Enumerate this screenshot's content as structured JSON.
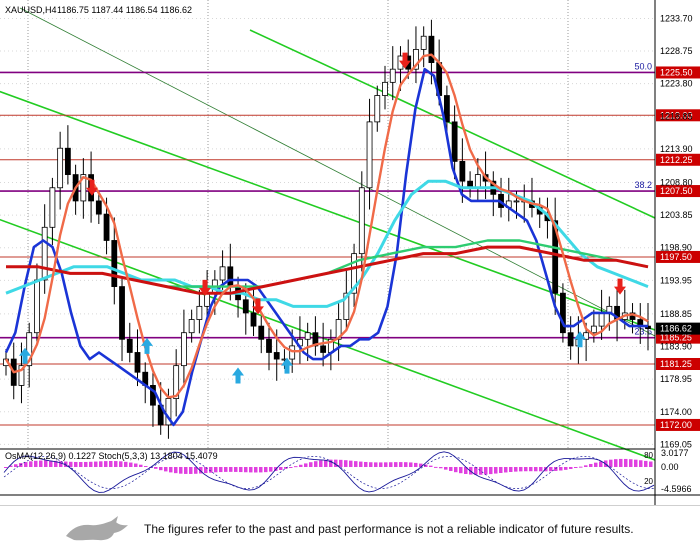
{
  "header": {
    "symbol": "XAUUSD,H4",
    "ohlc": "1186.75 1187.44 1186.54 1186.62"
  },
  "indicator_label": "OsMA(12,26,9) 0.1227  Stoch(5,3,3) 13.1804 15.4079",
  "footer": {
    "disclaimer": "The figures refer to the past and past performance is not a reliable indicator of future results."
  },
  "colors": {
    "level_line": "#800080",
    "level_label_bg": "#cc0000",
    "current_price_bg": "#000000",
    "ema_blue": "#1a34d6",
    "ema_cyan": "#3fd9e6",
    "ema_red": "#cc1111",
    "ema_salmon": "#f06a48",
    "channel_green": "#22cc22",
    "up_arrow": "#29a9e0",
    "down_arrow": "#e8211b",
    "osma_bar": "#e040e0"
  },
  "chart_data": {
    "type": "candlestick",
    "symbol": "XAUUSD",
    "timeframe": "H4",
    "ylim": [
      1168.5,
      1236.5
    ],
    "y_ticks": [
      1233.7,
      1228.75,
      1223.8,
      1218.85,
      1213.9,
      1208.8,
      1203.85,
      1198.9,
      1193.95,
      1188.85,
      1183.9,
      1178.95,
      1174.0,
      1169.05
    ],
    "horizontal_levels": [
      {
        "price": 1225.5,
        "label": "1225.50",
        "fib": "50.0"
      },
      {
        "price": 1219.0,
        "label": "1219.00"
      },
      {
        "price": 1212.25,
        "label": "1212.25"
      },
      {
        "price": 1207.5,
        "label": "1207.50",
        "fib": "38.2"
      },
      {
        "price": 1197.5,
        "label": "1197.50"
      },
      {
        "price": 1185.25,
        "label": "1185.25",
        "fib": "23.6"
      },
      {
        "price": 1181.25,
        "label": "1181.25"
      },
      {
        "price": 1172.0,
        "label": "1172.00"
      }
    ],
    "current_price": 1186.62,
    "closes": [
      1182,
      1178,
      1181,
      1186,
      1194,
      1202,
      1208,
      1214,
      1210,
      1206,
      1210,
      1206,
      1204,
      1200,
      1193,
      1185,
      1183,
      1180,
      1178,
      1175,
      1172,
      1176,
      1181,
      1186,
      1188,
      1190,
      1192,
      1194,
      1196,
      1193,
      1191,
      1189,
      1187,
      1185,
      1183,
      1182,
      1182,
      1184,
      1185,
      1186,
      1184,
      1183,
      1185,
      1188,
      1192,
      1198,
      1208,
      1218,
      1222,
      1224,
      1226,
      1228,
      1226,
      1229,
      1231,
      1227,
      1222,
      1218,
      1212,
      1209,
      1208,
      1210,
      1209,
      1207,
      1205,
      1206,
      1206,
      1206,
      1205,
      1204,
      1203,
      1192,
      1186,
      1184,
      1185,
      1186,
      1187,
      1189,
      1190,
      1188,
      1189,
      1188,
      1187,
      1186.62
    ],
    "ma_lines": [
      {
        "name": "ema_blue",
        "values": [
          1183,
          1186,
          1193,
          1199,
          1200,
          1199,
          1195,
          1189,
          1184,
          1182,
          1183,
          1182,
          1181,
          1180,
          1179,
          1178,
          1177,
          1174,
          1172,
          1174,
          1180,
          1185,
          1190,
          1193,
          1194,
          1194,
          1194,
          1193,
          1191,
          1189,
          1187,
          1185,
          1183,
          1182,
          1182,
          1183,
          1184,
          1184,
          1185,
          1185,
          1186,
          1190,
          1198,
          1210,
          1220,
          1226,
          1225,
          1219,
          1211,
          1207,
          1206,
          1206,
          1206,
          1206,
          1205,
          1204,
          1203,
          1200,
          1195,
          1190,
          1187,
          1187,
          1188,
          1189,
          1189,
          1189,
          1188,
          1187,
          1187,
          1187
        ]
      },
      {
        "name": "ema_cyan",
        "values": [
          1192,
          1193,
          1194,
          1195,
          1196,
          1196,
          1196,
          1195,
          1194,
          1194,
          1194,
          1193,
          1193,
          1192,
          1192,
          1191,
          1191,
          1190,
          1190,
          1190,
          1191,
          1194,
          1198,
          1203,
          1207,
          1209,
          1209,
          1208,
          1208,
          1208,
          1207,
          1206,
          1204,
          1201,
          1198,
          1196,
          1195,
          1194,
          1193
        ]
      },
      {
        "name": "ema_green",
        "values": [
          1196,
          1196,
          1195,
          1195,
          1194,
          1193,
          1193,
          1193,
          1193,
          1194,
          1195,
          1197,
          1198,
          1199,
          1199,
          1200,
          1200,
          1199,
          1198,
          1197,
          1196
        ]
      },
      {
        "name": "ema_red",
        "values": [
          1196,
          1196,
          1195,
          1195,
          1194,
          1193,
          1192,
          1192,
          1193,
          1194,
          1195,
          1196,
          1197,
          1198,
          1198,
          1199,
          1199,
          1198,
          1197,
          1197,
          1196
        ]
      }
    ],
    "signal_arrows": [
      {
        "dir": "down",
        "price": 1208.0
      },
      {
        "dir": "down",
        "price": 1192.8
      },
      {
        "dir": "down",
        "price": 1190.0
      },
      {
        "dir": "down",
        "price": 1227.3
      },
      {
        "dir": "down",
        "price": 1193.0
      },
      {
        "dir": "up",
        "price": 1182.5
      },
      {
        "dir": "up",
        "price": 1184.0
      },
      {
        "dir": "up",
        "price": 1179.5
      },
      {
        "dir": "up",
        "price": 1181.0
      },
      {
        "dir": "up",
        "price": 1185.0
      }
    ],
    "oscillators": {
      "osma": 0.1227,
      "stoch_main": 13.1804,
      "stoch_signal": 15.4079,
      "osma_ticks": [
        "3.0177",
        "0.00",
        "-4.5966"
      ],
      "stoch_levels": [
        80,
        20
      ]
    }
  }
}
